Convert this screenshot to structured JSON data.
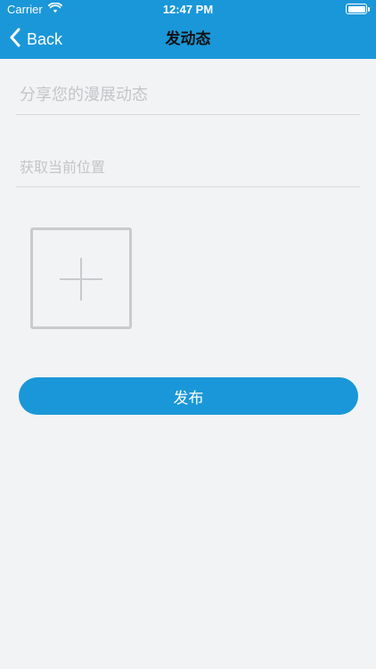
{
  "status_bar": {
    "carrier": "Carrier",
    "time": "12:47 PM",
    "battery_level": 1.0
  },
  "nav": {
    "back_label": "Back",
    "title": "发动态"
  },
  "form": {
    "share_placeholder": "分享您的漫展动态",
    "location_placeholder": "获取当前位置"
  },
  "publish_label": "发布",
  "icons": {
    "back": "chevron-left-icon",
    "add": "plus-icon",
    "wifi": "wifi-icon",
    "battery": "battery-icon"
  },
  "colors": {
    "primary": "#1a97d8",
    "background": "#f2f3f5",
    "placeholder": "#c4c5c8",
    "divider": "#d8d9dc",
    "add_border": "#c9cacd"
  }
}
